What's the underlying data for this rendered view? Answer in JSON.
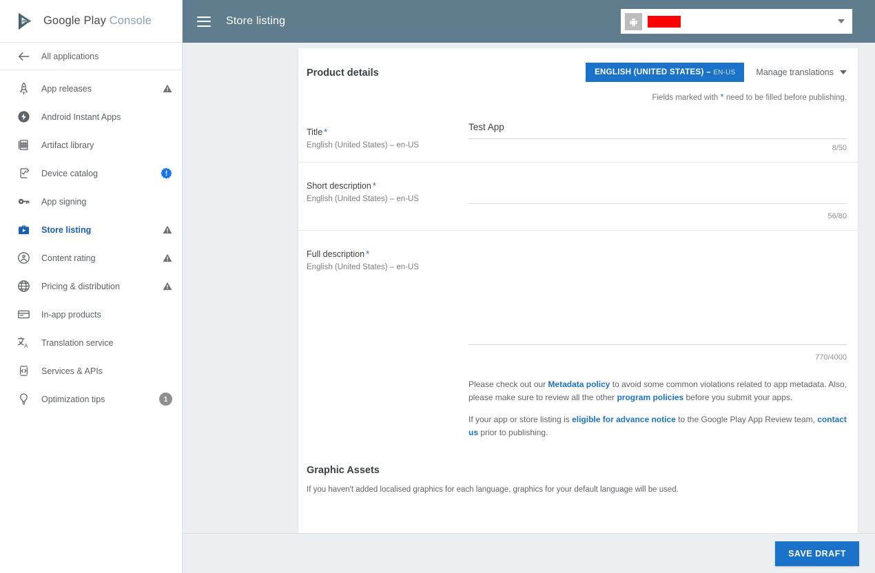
{
  "brand": {
    "name_primary": "Google Play",
    "name_secondary": "Console",
    "logo_icon": "google-play-logo"
  },
  "sidebar": {
    "back": {
      "label": "All applications",
      "icon": "arrow-left-icon"
    },
    "items": [
      {
        "label": "App releases",
        "icon": "rocket-icon",
        "badge": "warning",
        "badge_text": "",
        "active": false
      },
      {
        "label": "Android Instant Apps",
        "icon": "instant-apps-icon",
        "badge": "",
        "badge_text": "",
        "active": false
      },
      {
        "label": "Artifact library",
        "icon": "artifact-icon",
        "badge": "",
        "badge_text": "",
        "active": false
      },
      {
        "label": "Device catalog",
        "icon": "device-catalog-icon",
        "badge": "info",
        "badge_text": "!",
        "active": false
      },
      {
        "label": "App signing",
        "icon": "key-icon",
        "badge": "",
        "badge_text": "",
        "active": false
      },
      {
        "label": "Store listing",
        "icon": "store-listing-icon",
        "badge": "warning",
        "badge_text": "",
        "active": true
      },
      {
        "label": "Content rating",
        "icon": "content-rating-icon",
        "badge": "warning",
        "badge_text": "",
        "active": false
      },
      {
        "label": "Pricing & distribution",
        "icon": "globe-icon",
        "badge": "warning",
        "badge_text": "",
        "active": false
      },
      {
        "label": "In-app products",
        "icon": "card-icon",
        "badge": "",
        "badge_text": "",
        "active": false
      },
      {
        "label": "Translation service",
        "icon": "translate-icon",
        "badge": "",
        "badge_text": "",
        "active": false
      },
      {
        "label": "Services & APIs",
        "icon": "services-apis-icon",
        "badge": "",
        "badge_text": "",
        "active": false
      },
      {
        "label": "Optimization tips",
        "icon": "lightbulb-icon",
        "badge": "count",
        "badge_text": "1",
        "active": false
      }
    ]
  },
  "topbar": {
    "menu_icon": "hamburger-icon",
    "title": "Store listing",
    "app_selector": {
      "icon": "android-app-icon",
      "name": "",
      "redacted": true,
      "caret_icon": "chevron-down-icon"
    },
    "info_icon": "info-circle-icon",
    "background": "#5f7d8c"
  },
  "main": {
    "section_title": "Product details",
    "language_chip": {
      "label": "ENGLISH (UNITED STATES)",
      "separator": " – ",
      "code": "EN-US",
      "color": "#1a73c8"
    },
    "manage_translations": "Manage translations",
    "required_hint_before": "Fields marked with",
    "required_hint_star": "*",
    "required_hint_after": "need to be filled before publishing.",
    "fields": [
      {
        "label": "Title",
        "required_star": "*",
        "sublabel": "English (United States) – en-US",
        "value": "Test App",
        "placeholder": "",
        "counter": "8/50"
      },
      {
        "label": "Short description",
        "required_star": "*",
        "sublabel": "English (United States) – en-US",
        "value": "",
        "placeholder": "",
        "counter": "56/80"
      },
      {
        "label": "Full description",
        "required_star": "*",
        "sublabel": "English (United States) – en-US",
        "value": "",
        "placeholder": "",
        "counter": "770/4000"
      }
    ],
    "policy": {
      "p1_a": "Please check out our ",
      "p1_link1": "Metadata policy",
      "p1_b": " to avoid some common violations related to app metadata. Also, please make sure to review all the other ",
      "p1_link2": "program policies",
      "p1_c": " before you submit your apps.",
      "p2_a": "If your app or store listing is ",
      "p2_link1": "eligible for advance notice",
      "p2_b": " to the Google Play App Review team, ",
      "p2_link2": "contact us",
      "p2_c": " prior to publishing."
    },
    "graphic_assets_title": "Graphic Assets",
    "graphic_assets_sub": "If you haven't added localised graphics for each language, graphics for your default language will be used."
  },
  "savebar": {
    "save_label": "SAVE DRAFT",
    "color": "#1a73c8"
  }
}
